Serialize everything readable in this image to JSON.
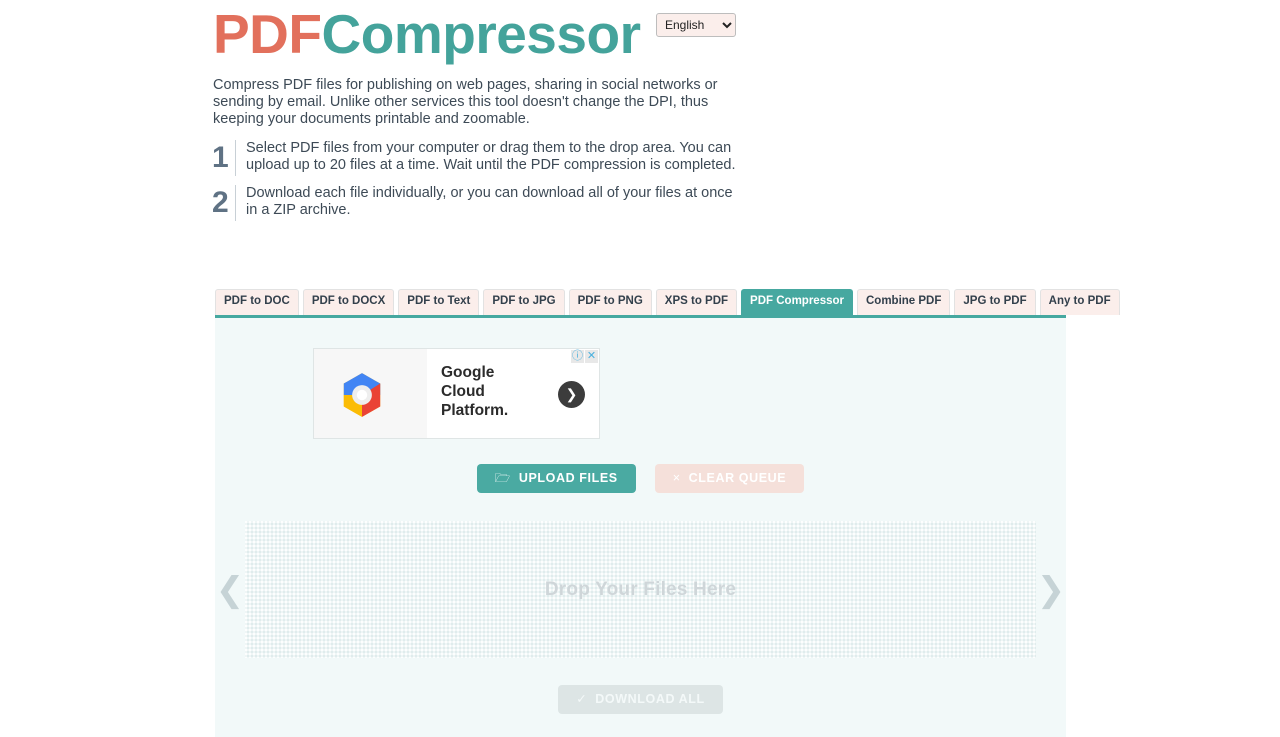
{
  "header": {
    "logo_part1": "PDF",
    "logo_part2": "Compressor",
    "language": {
      "selected": "English",
      "options": [
        "English"
      ]
    }
  },
  "intro": {
    "text": "Compress PDF files for publishing on web pages, sharing in social networks or sending by email. Unlike other services this tool doesn't change the DPI, thus keeping your documents printable and zoomable."
  },
  "steps": [
    {
      "number": "1",
      "text": "Select PDF files from your computer or drag them to the drop area. You can upload up to 20 files at a time. Wait until the PDF compression is completed."
    },
    {
      "number": "2",
      "text": "Download each file individually, or you can download all of your files at once in a ZIP archive."
    }
  ],
  "tabs": [
    {
      "label": "PDF to DOC",
      "active": false
    },
    {
      "label": "PDF to DOCX",
      "active": false
    },
    {
      "label": "PDF to Text",
      "active": false
    },
    {
      "label": "PDF to JPG",
      "active": false
    },
    {
      "label": "PDF to PNG",
      "active": false
    },
    {
      "label": "XPS to PDF",
      "active": false
    },
    {
      "label": "PDF Compressor",
      "active": true
    },
    {
      "label": "Combine PDF",
      "active": false
    },
    {
      "label": "JPG to PDF",
      "active": false
    },
    {
      "label": "Any to PDF",
      "active": false
    }
  ],
  "ad": {
    "line1": "Google",
    "line2": "Cloud",
    "line3": "Platform.",
    "arrow_glyph": "❯",
    "info_glyph": "ⓘ",
    "close_glyph": "✕"
  },
  "toolbar": {
    "upload_label": "UPLOAD FILES",
    "upload_icon_glyph": "📂",
    "clear_label": "CLEAR QUEUE",
    "clear_icon_glyph": "×"
  },
  "dropzone": {
    "label": "Drop Your Files Here",
    "prev_glyph": "❮",
    "next_glyph": "❯"
  },
  "download": {
    "label": "DOWNLOAD ALL",
    "icon_glyph": "✓"
  },
  "colors": {
    "brand_teal": "#46a8a0",
    "brand_coral": "#e2705c",
    "panel_bg": "#f2f9f9",
    "tab_bg": "#fbeeeb",
    "text_dark": "#3d4a56"
  }
}
